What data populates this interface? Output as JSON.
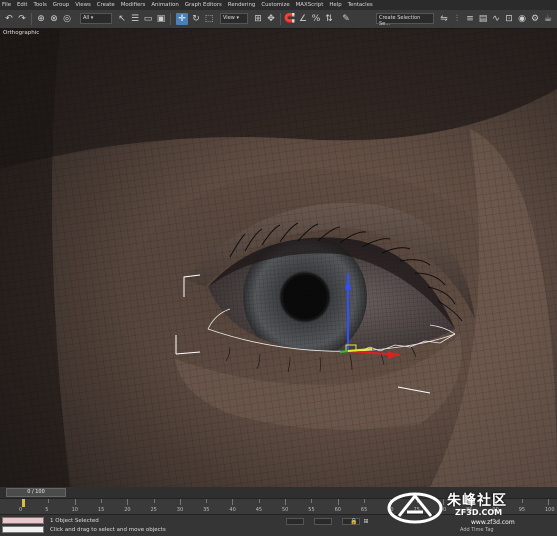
{
  "menu": [
    "File",
    "Edit",
    "Tools",
    "Group",
    "Views",
    "Create",
    "Modifiers",
    "Animation",
    "Graph Editors",
    "Rendering",
    "Customize",
    "MAXScript",
    "Help",
    "Tentacles"
  ],
  "toolbar": {
    "selection_filter": "All",
    "ref_coord": "View",
    "named_selection": "Create Selection Se..."
  },
  "viewport": {
    "label": "Orthographic"
  },
  "timeline": {
    "frame_display": "0 / 100",
    "ticks": [
      0,
      5,
      10,
      15,
      20,
      25,
      30,
      35,
      40,
      45,
      50,
      55,
      60,
      65,
      70,
      75,
      80,
      85,
      90,
      95,
      100
    ]
  },
  "status": {
    "line1": "1 Object Selected",
    "line2": "Click and drag to select and move objects",
    "add_time_tag": "Add Time Tag"
  },
  "watermark": {
    "text": "朱峰社区",
    "url": "ZF3D.COM",
    "url2": "www.zf3d.com"
  },
  "colors": {
    "accent": "#4a7fb8",
    "viewport_bg": "#2a2220",
    "skin": "#6b5548"
  }
}
